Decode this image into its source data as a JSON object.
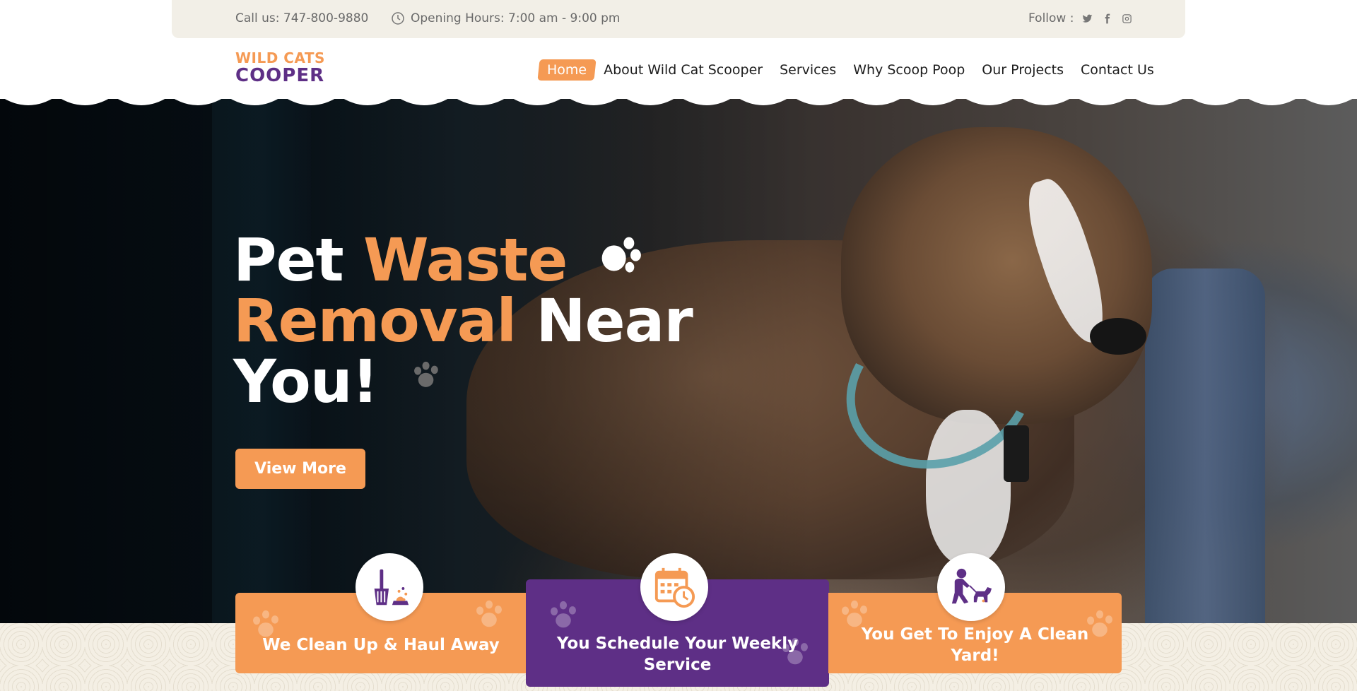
{
  "topbar": {
    "phone": "Call us: 747-800-9880",
    "hours": "Opening Hours: 7:00 am - 9:00 pm",
    "follow_label": "Follow :",
    "social_icons": [
      "twitter-icon",
      "facebook-icon",
      "instagram-icon"
    ]
  },
  "logo": {
    "line1": "WILD CATS",
    "line2": "COOPER"
  },
  "nav": {
    "items": [
      {
        "label": "Home",
        "active": true
      },
      {
        "label": "About Wild Cat Scooper"
      },
      {
        "label": "Services"
      },
      {
        "label": "Why Scoop Poop"
      },
      {
        "label": "Our Projects"
      },
      {
        "label": "Contact Us"
      }
    ]
  },
  "hero": {
    "line1_white": "Pet ",
    "line1_orange": "Waste",
    "line2_orange": "Removal",
    "line2_white": " Near",
    "line3_white": "You!",
    "button_label": "View More"
  },
  "features": [
    {
      "label": "We Clean Up & Haul Away",
      "icon": "scooper-icon"
    },
    {
      "label": "You Schedule Your Weekly Service",
      "icon": "calendar-clock-icon"
    },
    {
      "label": "You Get To Enjoy A Clean Yard!",
      "icon": "person-with-dog-icon"
    }
  ],
  "colors": {
    "accent": "#f59a54",
    "brand_purple": "#5e2f86",
    "topbar_bg": "#f2efe7"
  }
}
